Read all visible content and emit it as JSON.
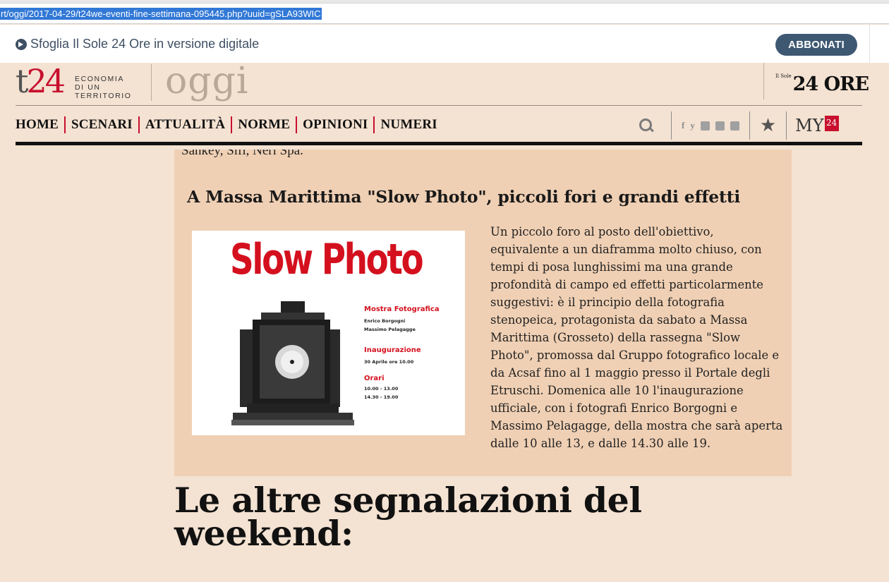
{
  "browser": {
    "url": "rt/oggi/2017-04-29/t24we-eventi-fine-settimana-095445.php?uuid=gSLA93WIC"
  },
  "banner": {
    "sfoglia_text": "Sfoglia Il Sole 24 Ore in versione digitale",
    "subscribe_label": "ABBONATI"
  },
  "masthead": {
    "logo_t": "t",
    "logo_24": "24",
    "logo_sub": [
      "ECONOMIA",
      "DI UN",
      "TERRITORIO"
    ],
    "section_name": "oggi",
    "publisher_small": "Il Sole",
    "publisher_big": "24 ORE"
  },
  "nav": {
    "items": [
      "HOME",
      "SCENARI",
      "ATTUALITÀ",
      "NORME",
      "OPINIONI",
      "NUMERI"
    ],
    "social": [
      "f",
      "y",
      "in"
    ],
    "my_label": "MY",
    "my_badge": "24"
  },
  "article": {
    "cut_text": "Sankey, Sifi, Neri Spa.",
    "title": "A Massa Marittima \"Slow Photo\", piccoli fori e grandi effetti",
    "body": "Un piccolo foro al posto dell'obiettivo, equivalente a un diaframma molto chiuso, con tempi di posa lunghissimi ma una grande profondità di campo ed effetti particolarmente suggestivi: è il principio della fotografia stenopeica, protagonista da sabato a Massa Marittima (Grosseto) della rassegna \"Slow Photo\", promossa dal Gruppo fotografico locale e da Acsaf fino al 1 maggio presso il Portale degli Etruschi. Domenica alle 10 l'inaugurazione ufficiale, con i fotografi Enrico Borgogni e Massimo Pelagagge, della mostra che sarà aperta dalle 10 alle 13, e dalle 14.30 alle 19.",
    "poster": {
      "title": "Slow Photo",
      "mostra": "Mostra Fotografica",
      "author1": "Enrico Borgogni",
      "author2": "Massimo Pelagagge",
      "inaugurazione": "Inaugurazione",
      "date": "30 Aprile   ore 10.00",
      "orari": "Orari",
      "hours1": "10.00 - 13.00",
      "hours2": "14.30 - 19.00"
    }
  },
  "section": {
    "title": "Le altre segnalazioni del weekend:"
  },
  "colors": {
    "page_bg": "#f4e2d2",
    "article_bg": "#f0d0b4",
    "accent_red": "#c8102e",
    "button_blue": "#3f5872",
    "url_highlight": "#3178d6"
  }
}
